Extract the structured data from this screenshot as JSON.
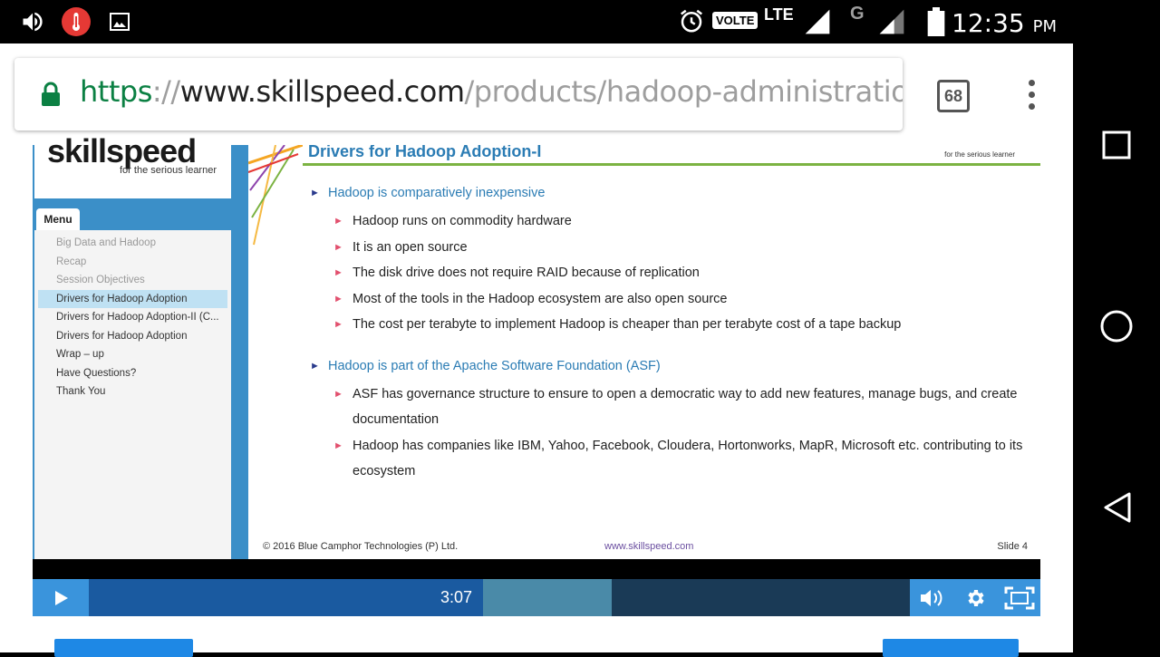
{
  "status_bar": {
    "network_label": "VOLTE",
    "lte_label": "LTE",
    "g_label": "G",
    "time": "12:35",
    "ampm": "PM",
    "icons": [
      "volume-icon",
      "thermometer-icon",
      "image-icon",
      "alarm-icon",
      "signal-icon",
      "battery-icon"
    ]
  },
  "browser": {
    "url_scheme": "https",
    "url_sep": "://",
    "url_host": "www.skillspeed.com",
    "url_path": "/products/hadoop-administration/c",
    "tab_count": "68"
  },
  "course": {
    "logo_text": "skillspeed",
    "tagline": "for the serious learner",
    "menu_label": "Menu",
    "menu_items": [
      {
        "label": "Big Data and Hadoop",
        "state": "dim"
      },
      {
        "label": "Recap",
        "state": "dim"
      },
      {
        "label": "Session Objectives",
        "state": "dim"
      },
      {
        "label": "Drivers for Hadoop Adoption",
        "state": "active"
      },
      {
        "label": "Drivers for Hadoop Adoption-II (C...",
        "state": "normal"
      },
      {
        "label": "Drivers for Hadoop Adoption",
        "state": "normal"
      },
      {
        "label": "Wrap – up",
        "state": "normal"
      },
      {
        "label": "Have Questions?",
        "state": "normal"
      },
      {
        "label": "Thank You",
        "state": "normal"
      }
    ]
  },
  "slide": {
    "title": "Drivers for Hadoop Adoption-I",
    "corner_tag": "for the serious learner",
    "groups": [
      {
        "heading": "Hadoop is comparatively inexpensive",
        "items": [
          "Hadoop runs on commodity hardware",
          "It is an open source",
          "The disk drive does not require RAID because of replication",
          "Most of the tools in the Hadoop ecosystem are also open source",
          "The cost per terabyte to implement Hadoop is cheaper than per terabyte cost of a tape backup"
        ]
      },
      {
        "heading": "Hadoop is part of the Apache Software Foundation (ASF)",
        "items": [
          "ASF has governance structure to ensure to open a democratic way to add new features, manage bugs, and create documentation",
          "Hadoop has companies like IBM, Yahoo, Facebook, Cloudera, Hortonworks, MapR, Microsoft etc. contributing to its ecosystem"
        ]
      }
    ],
    "footer_left": "© 2016 Blue Camphor Technologies (P) Ltd.",
    "footer_center": "www.skillspeed.com",
    "footer_right": "Slide 4"
  },
  "player": {
    "current_time": "3:07"
  }
}
